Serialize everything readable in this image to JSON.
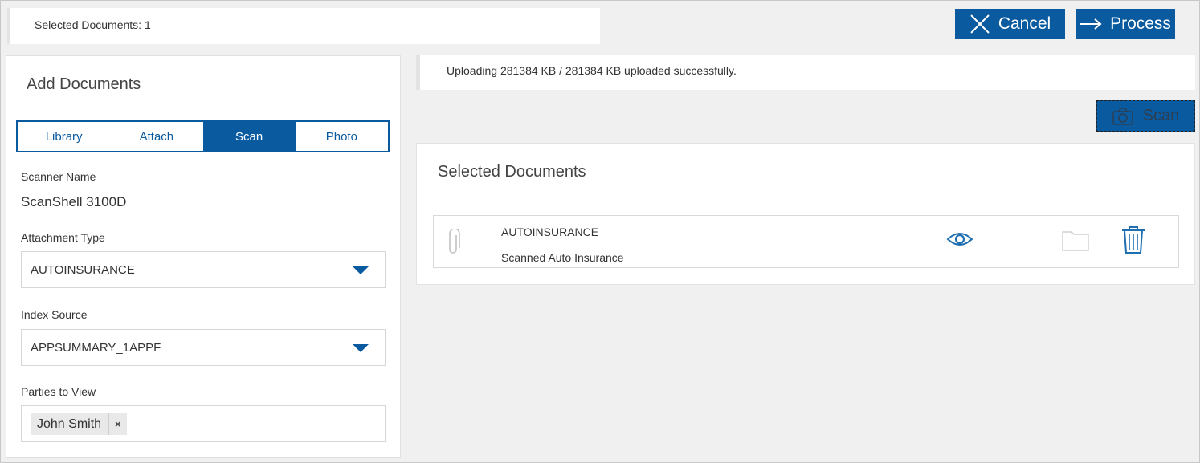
{
  "header": {
    "selected_documents": "Selected Documents: 1",
    "cancel_label": "Cancel",
    "process_label": "Process"
  },
  "left_panel": {
    "title": "Add Documents",
    "tabs": [
      {
        "label": "Library",
        "active": false
      },
      {
        "label": "Attach",
        "active": false
      },
      {
        "label": "Scan",
        "active": true
      },
      {
        "label": "Photo",
        "active": false
      }
    ],
    "scanner_name_label": "Scanner Name",
    "scanner_name_value": "ScanShell 3100D",
    "attachment_type_label": "Attachment Type",
    "attachment_type_value": "AUTOINSURANCE",
    "index_source_label": "Index Source",
    "index_source_value": "APPSUMMARY_1APPF",
    "parties_label": "Parties to View",
    "parties": [
      "John Smith"
    ],
    "tag_remove": "×"
  },
  "main": {
    "upload_status": "Uploading 281384 KB / 281384 KB uploaded successfully.",
    "scan_label": "Scan",
    "docs_title": "Selected Documents",
    "documents": [
      {
        "name": "AUTOINSURANCE",
        "description": "Scanned Auto Insurance"
      }
    ]
  },
  "icons": {
    "cancel": "close-icon",
    "process": "arrow-right-icon",
    "scan": "camera-icon",
    "attachment": "paperclip-icon",
    "view": "eye-icon",
    "folder": "folder-icon",
    "delete": "trash-icon"
  },
  "colors": {
    "primary": "#0a5aa0",
    "background": "#f0f0f0",
    "panel": "#ffffff"
  }
}
